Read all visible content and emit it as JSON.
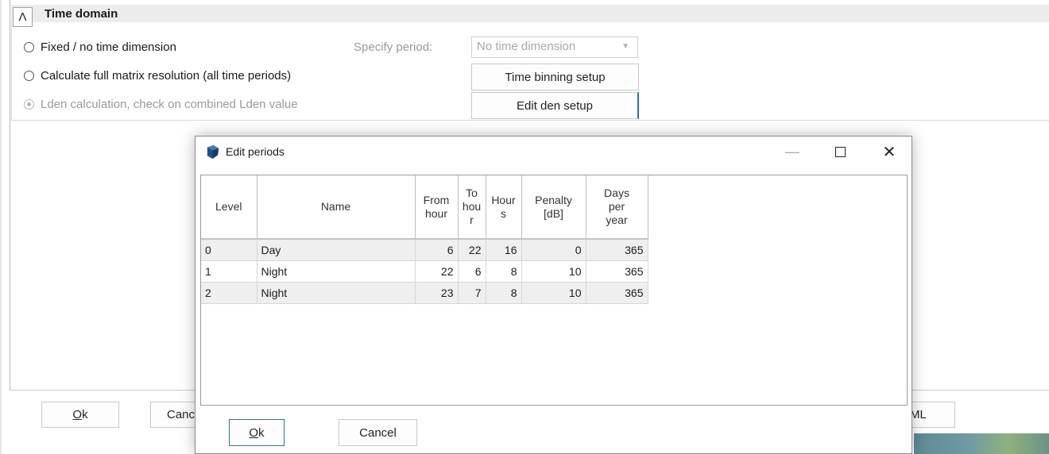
{
  "section": {
    "title": "Time domain",
    "collapse_icon": "chevron-up-icon"
  },
  "options": {
    "fixed_label": "Fixed / no time dimension",
    "full_label": "Calculate full matrix resolution (all time periods)",
    "lden_label": "Lden calculation, check on combined Lden value",
    "selected": "lden"
  },
  "period": {
    "label": "Specify period:",
    "value": "No time dimension"
  },
  "buttons": {
    "time_binning": "Time binning setup",
    "edit_den": "Edit den setup"
  },
  "background_buttons": {
    "ok_letter": "O",
    "ok_rest": "k",
    "cancel_partial": "Canc",
    "xml_partial": "ML"
  },
  "dialog": {
    "title": "Edit periods",
    "minimize_glyph": "—",
    "close_glyph": "✕",
    "ok_letter": "O",
    "ok_rest": "k",
    "cancel_label": "Cancel"
  },
  "grid": {
    "headers": [
      "Level",
      "Name",
      "From\nhour",
      "To\nhou\nr",
      "Hour\ns",
      "Penalty\n[dB]",
      "Days\nper\nyear"
    ],
    "rows": [
      [
        "0",
        "Day",
        "6",
        "22",
        "16",
        "0",
        "365"
      ],
      [
        "1",
        "Night",
        "22",
        "6",
        "8",
        "10",
        "365"
      ],
      [
        "2",
        "Night",
        "23",
        "7",
        "8",
        "10",
        "365"
      ]
    ]
  },
  "colors": {
    "accent": "#2a6ebf",
    "header_bg": "#ececec",
    "row_alt": "#efefef"
  }
}
